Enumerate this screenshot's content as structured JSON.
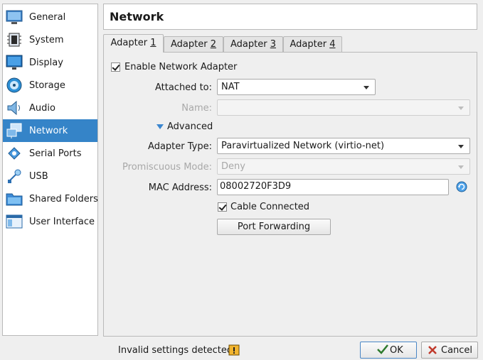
{
  "sidebar": {
    "items": [
      {
        "label": "General",
        "icon": "general-icon"
      },
      {
        "label": "System",
        "icon": "system-chip-icon"
      },
      {
        "label": "Display",
        "icon": "display-monitor-icon"
      },
      {
        "label": "Storage",
        "icon": "storage-disk-icon"
      },
      {
        "label": "Audio",
        "icon": "audio-speaker-icon"
      },
      {
        "label": "Network",
        "icon": "network-icon"
      },
      {
        "label": "Serial Ports",
        "icon": "serial-port-icon"
      },
      {
        "label": "USB",
        "icon": "usb-icon"
      },
      {
        "label": "Shared Folders",
        "icon": "shared-folder-icon"
      },
      {
        "label": "User Interface",
        "icon": "user-interface-icon"
      }
    ],
    "active": "Network"
  },
  "header": {
    "title": "Network"
  },
  "tabs": [
    {
      "label": "Adapter ",
      "accel": "1"
    },
    {
      "label": "Adapter ",
      "accel": "2"
    },
    {
      "label": "Adapter ",
      "accel": "3"
    },
    {
      "label": "Adapter ",
      "accel": "4"
    }
  ],
  "adapter": {
    "enable_label": "Enable Network Adapter",
    "enable_checked": true,
    "attached_label": "Attached to:",
    "attached_value": "NAT",
    "name_label": "Name:",
    "name_value": "",
    "advanced_label": "Advanced",
    "adapter_type_label": "Adapter Type:",
    "adapter_type_value": "Paravirtualized Network (virtio-net)",
    "promiscuous_label": "Promiscuous Mode:",
    "promiscuous_value": "Deny",
    "mac_label": "MAC Address:",
    "mac_value": "08002720F3D9",
    "cable_label": "Cable Connected",
    "cable_checked": true,
    "port_forwarding_label": "Port Forwarding"
  },
  "footer": {
    "status": "Invalid settings detected",
    "ok_label": "OK",
    "cancel_label": "Cancel"
  },
  "colors": {
    "accent": "#3584c8",
    "warning": "#f2b530"
  }
}
